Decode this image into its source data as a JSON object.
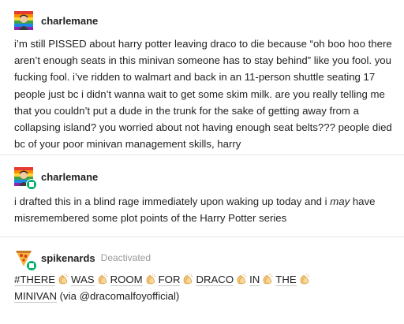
{
  "posts": [
    {
      "username": "charlemane",
      "text": "i’m still PISSED about harry potter leaving draco to die because “oh boo hoo there aren’t enough seats in this minivan someone has to stay behind” like you fool. you fucking fool. i’ve ridden to walmart and back in an 11-person shuttle seating 17 people just bc i didn’t wanna wait to get some skim milk. are you really telling me that you couldn’t put a dude in the trunk for the sake of getting away from a collapsing island? you worried about not having enough seat belts??? people died bc of your poor minivan management skills, harry"
    },
    {
      "username": "charlemane",
      "text_before": "i drafted this in a blind rage immediately upon waking up today and i ",
      "text_em": "may",
      "text_after": " have misremembered some plot points of the Harry Potter series"
    },
    {
      "username": "spikenards",
      "status": "Deactivated",
      "tag_words": [
        "#THERE",
        "WAS",
        "ROOM",
        "FOR",
        "DRACO",
        "IN",
        "THE"
      ],
      "tag_line2": "MINIVAN",
      "via": "(via @dracomalfoyofficial)"
    }
  ],
  "icons": {
    "clap": "clapping-hands-emoji",
    "avatar1": "rainbow-avatar",
    "avatar3": "pizza-avatar",
    "badge": "follow-badge-icon"
  },
  "colors": {
    "badge": "#00b06b",
    "divider": "#e6e6e6",
    "text": "#222222",
    "muted": "#9a9a9a"
  }
}
